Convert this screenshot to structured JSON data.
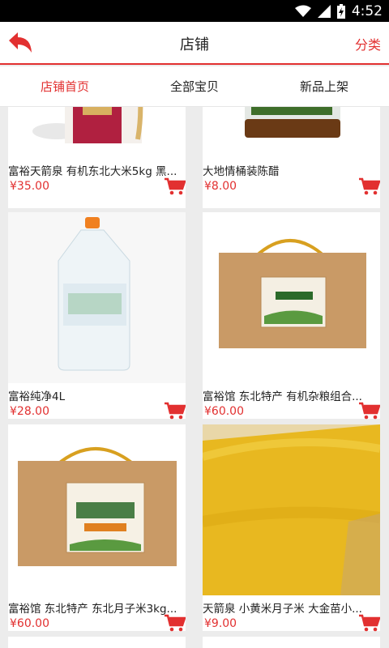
{
  "status": {
    "time": "4:52"
  },
  "nav": {
    "title": "店铺",
    "category": "分类"
  },
  "tabs": [
    "店铺首页",
    "全部宝贝",
    "新品上架"
  ],
  "products": [
    {
      "name": "富裕天箭泉 有机东北大米5kg 黑...",
      "price": "¥35.00"
    },
    {
      "name": "大地情桶装陈醋",
      "price": "¥8.00"
    },
    {
      "name": "富裕纯净4L",
      "price": "¥28.00"
    },
    {
      "name": "富裕馆 东北特产 有机杂粮组合...",
      "price": "¥60.00"
    },
    {
      "name": "富裕馆 东北特产 东北月子米3kg...",
      "price": "¥60.00"
    },
    {
      "name": "天箭泉 小黄米月子米 大金苗小...",
      "price": "¥9.00"
    }
  ],
  "colors": {
    "accent": "#e23030"
  }
}
